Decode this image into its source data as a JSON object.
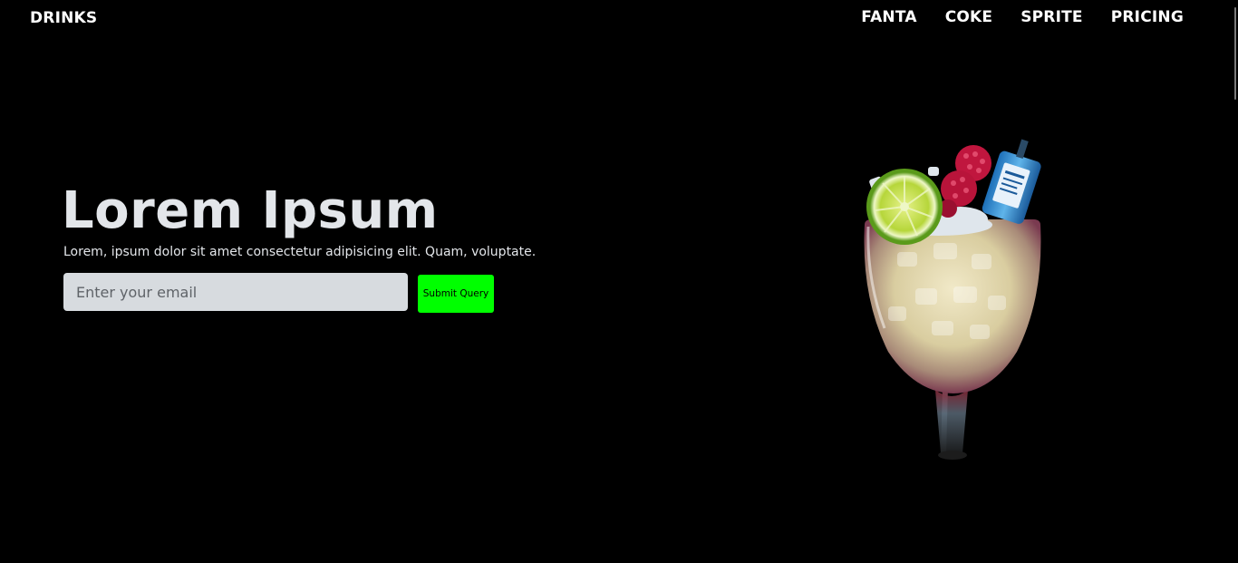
{
  "brand": "DRINKS",
  "nav": {
    "items": [
      "FANTA",
      "COKE",
      "SPRITE",
      "PRICING"
    ]
  },
  "hero": {
    "title": "Lorem Ipsum",
    "subtitle": "Lorem, ipsum dolor sit amet consectetur adipisicing elit. Quam, voluptate.",
    "email_placeholder": "Enter your email",
    "email_value": "",
    "submit_label": "Submit Query"
  },
  "colors": {
    "background": "#000000",
    "submit_button": "#00ff00",
    "input_background": "#d7dbdf"
  },
  "icons": {
    "hero_image": "cocktail-glass-image"
  }
}
